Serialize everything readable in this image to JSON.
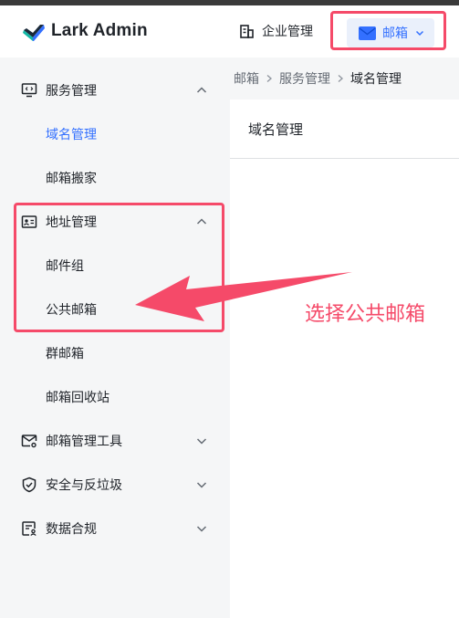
{
  "app": {
    "logo_text": "Lark Admin"
  },
  "header": {
    "nav_org_label": "企业管理",
    "nav_mail_label": "邮箱"
  },
  "sidebar": {
    "items": [
      {
        "label": "服务管理",
        "icon": "monitor-code-icon",
        "type": "group",
        "expanded": true
      },
      {
        "label": "域名管理",
        "type": "sub",
        "active": true
      },
      {
        "label": "邮箱搬家",
        "type": "sub"
      },
      {
        "label": "地址管理",
        "icon": "contact-card-icon",
        "type": "group",
        "expanded": true
      },
      {
        "label": "邮件组",
        "type": "sub"
      },
      {
        "label": "公共邮箱",
        "type": "sub"
      },
      {
        "label": "群邮箱",
        "type": "sub"
      },
      {
        "label": "邮箱回收站",
        "type": "sub"
      },
      {
        "label": "邮箱管理工具",
        "icon": "mail-settings-icon",
        "type": "group",
        "expanded": false
      },
      {
        "label": "安全与反垃圾",
        "icon": "shield-check-icon",
        "type": "group",
        "expanded": false
      },
      {
        "label": "数据合规",
        "icon": "document-user-icon",
        "type": "group",
        "expanded": false
      }
    ]
  },
  "breadcrumb": [
    "邮箱",
    "服务管理",
    "域名管理"
  ],
  "main": {
    "panel_title": "域名管理"
  },
  "annotation": {
    "text": "选择公共邮箱"
  },
  "colors": {
    "accent": "#3370ff",
    "highlight": "#f54a69",
    "sidebar_bg": "#f5f6f7"
  }
}
